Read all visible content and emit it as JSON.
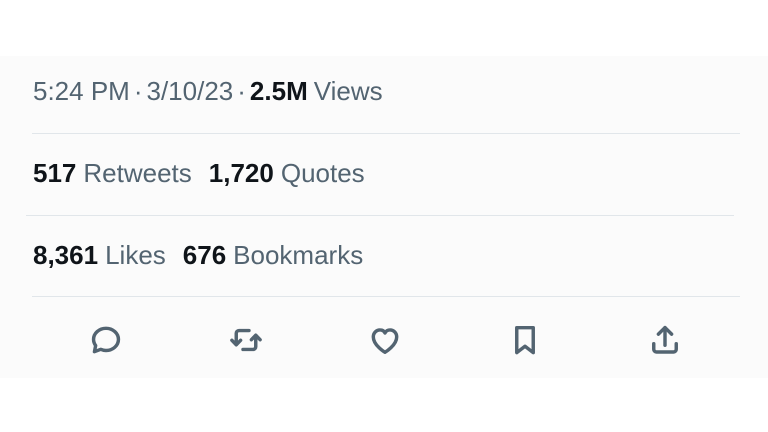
{
  "tweet_meta": {
    "time": "5:24 PM",
    "separator": "·",
    "date": "3/10/23",
    "views_count": "2.5M",
    "views_label": "Views"
  },
  "stats": {
    "retweets_count": "517",
    "retweets_label": "Retweets",
    "quotes_count": "1,720",
    "quotes_label": "Quotes",
    "likes_count": "8,361",
    "likes_label": "Likes",
    "bookmarks_count": "676",
    "bookmarks_label": "Bookmarks"
  },
  "actions": [
    {
      "icon": "reply-icon"
    },
    {
      "icon": "retweet-icon"
    },
    {
      "icon": "like-icon"
    },
    {
      "icon": "bookmark-icon"
    },
    {
      "icon": "share-icon"
    }
  ],
  "colors": {
    "text_primary": "#0f1419",
    "text_secondary": "#536471",
    "divider": "#e1e6ea"
  }
}
